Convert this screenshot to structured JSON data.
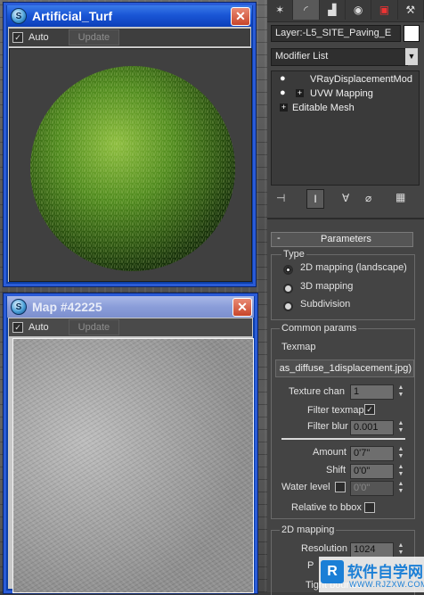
{
  "material_window": {
    "title": "Artificial_Turf",
    "auto_label": "Auto",
    "update_label": "Update",
    "close_glyph": "✕"
  },
  "map_window": {
    "title": "Map #42225",
    "auto_label": "Auto",
    "update_label": "Update",
    "close_glyph": "✕"
  },
  "command_panel": {
    "tab_icons": [
      "create-icon",
      "modify-icon",
      "hierarchy-icon",
      "motion-icon",
      "display-icon",
      "utilities-icon"
    ],
    "object_name": "Layer:-L5_SITE_Paving_E",
    "modifier_list": "Modifier List",
    "stack": [
      {
        "label": "VRayDisplacementMod",
        "has_bulb": true,
        "has_plus": false
      },
      {
        "label": "UVW Mapping",
        "has_bulb": true,
        "has_plus": true
      },
      {
        "label": "Editable Mesh",
        "has_bulb": false,
        "has_plus": true
      }
    ],
    "parameters": {
      "header": "Parameters",
      "collapse_glyph": "-",
      "type_group": "Type",
      "type_options": [
        "2D mapping (landscape)",
        "3D mapping",
        "Subdivision"
      ],
      "type_selected": 0,
      "common_group": "Common params",
      "texmap_label": "Texmap",
      "texmap_value": "as_diffuse_1displacement.jpg)",
      "texture_chan_label": "Texture chan",
      "texture_chan_value": "1",
      "filter_texmap_label": "Filter texmap",
      "filter_texmap_checked": "✓",
      "filter_blur_label": "Filter blur",
      "filter_blur_value": "0.001",
      "amount_label": "Amount",
      "amount_value": "0'7\"",
      "shift_label": "Shift",
      "shift_value": "0'0\"",
      "water_level_label": "Water level",
      "water_level_value": "0'0\"",
      "relative_label": "Relative to bbox",
      "mapping2d_group": "2D mapping",
      "resolution_label": "Resolution",
      "resolution_value": "1024",
      "precision_label": "P",
      "tight_bounds_label": "Tight bounds"
    }
  },
  "watermark": {
    "text": "软件自学网",
    "url": "WWW.RJZXW.COM"
  }
}
